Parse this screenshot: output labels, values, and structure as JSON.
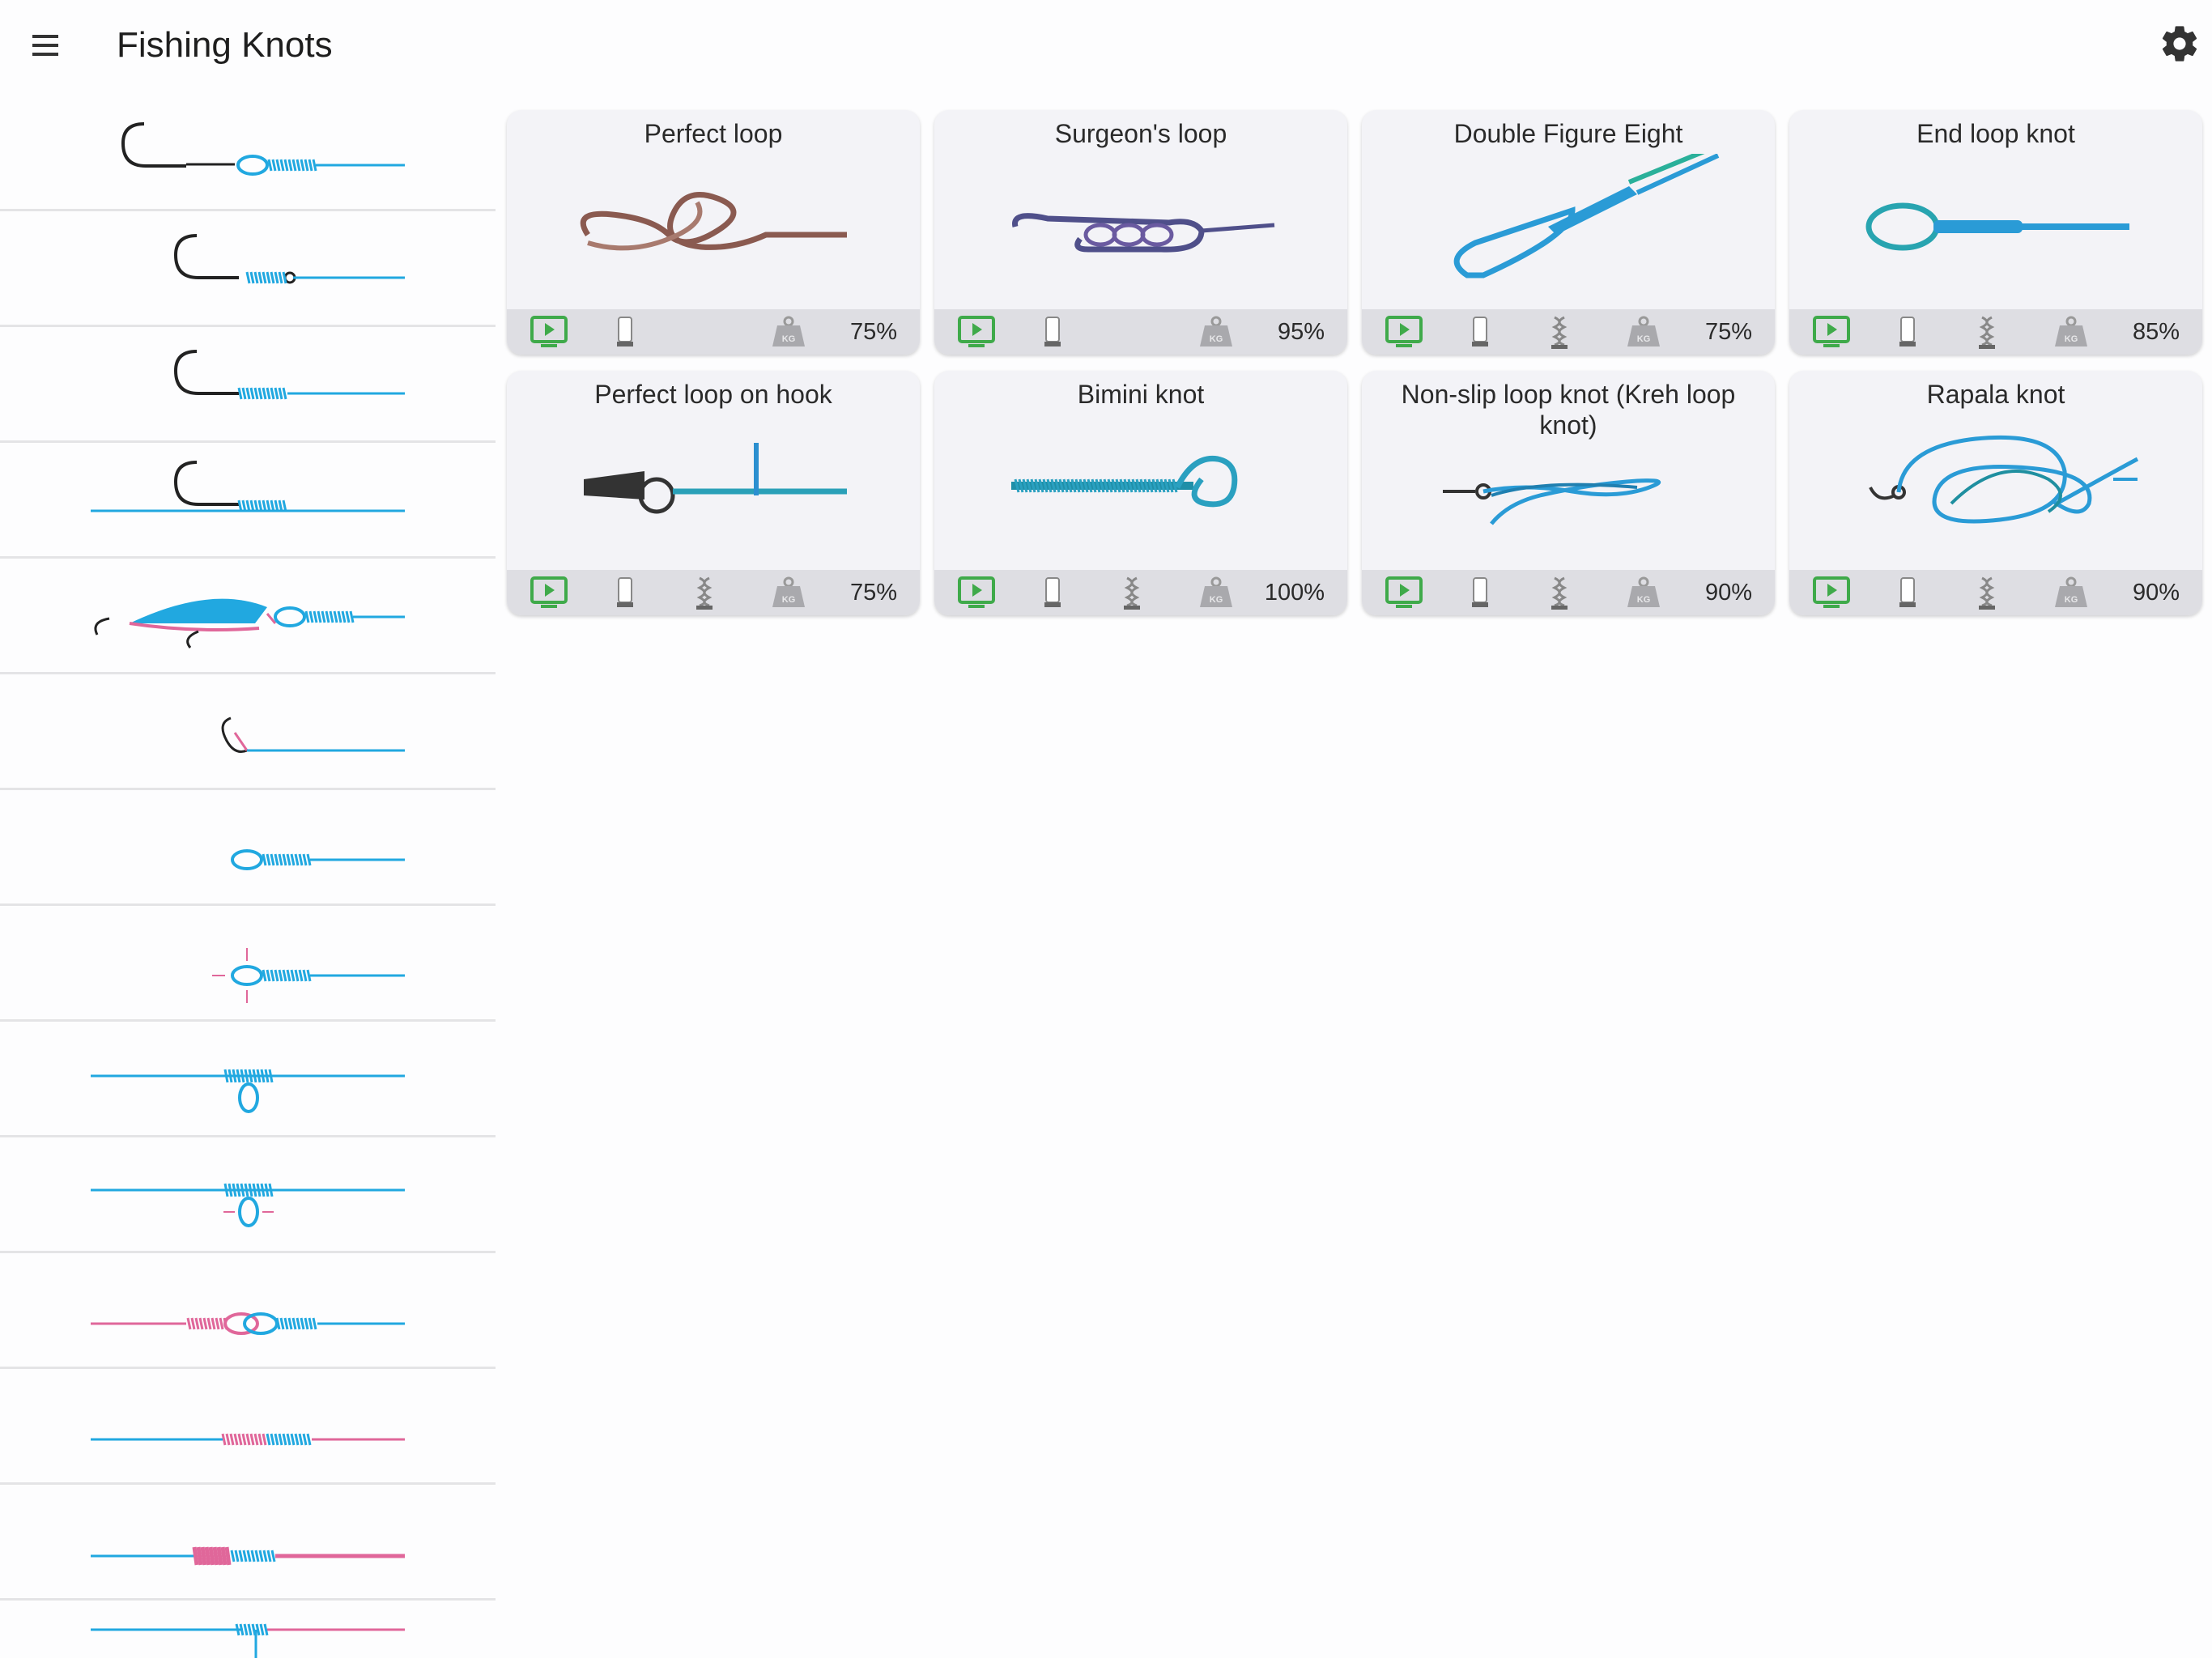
{
  "app": {
    "title": "Fishing Knots",
    "menu_icon": "hamburger-menu-icon",
    "settings_icon": "gear-icon"
  },
  "sidebar": {
    "items": [
      {
        "icon": "hook-loop-knot-icon"
      },
      {
        "icon": "hook-eye-knot-icon"
      },
      {
        "icon": "hook-shank-knot-icon"
      },
      {
        "icon": "hook-line-through-icon"
      },
      {
        "icon": "lure-loop-knot-icon"
      },
      {
        "icon": "snap-swivel-knot-icon"
      },
      {
        "icon": "end-loop-icon"
      },
      {
        "icon": "end-loop-crosshair-icon"
      },
      {
        "icon": "dropper-loop-icon"
      },
      {
        "icon": "dropper-loop-crosshair-icon"
      },
      {
        "icon": "loop-to-loop-icon"
      },
      {
        "icon": "line-to-line-icon"
      },
      {
        "icon": "leader-to-line-icon"
      },
      {
        "icon": "line-to-line-tag-icon"
      }
    ]
  },
  "knots": [
    {
      "title": "Perfect loop",
      "percent": "75%",
      "braid": false,
      "colors": [
        "#8a5a50",
        "#a87a6e"
      ]
    },
    {
      "title": "Surgeon's loop",
      "percent": "95%",
      "braid": false,
      "colors": [
        "#4f4f8a",
        "#6a5aa0"
      ]
    },
    {
      "title": "Double Figure Eight",
      "percent": "75%",
      "braid": true,
      "colors": [
        "#2a9bd6",
        "#2ab09a"
      ]
    },
    {
      "title": "End loop knot",
      "percent": "85%",
      "braid": true,
      "colors": [
        "#2a9bd6",
        "#28a4b0"
      ]
    },
    {
      "title": "Perfect loop on hook",
      "percent": "75%",
      "braid": true,
      "colors": [
        "#2aa0b8",
        "#2b8fd0"
      ]
    },
    {
      "title": "Bimini knot",
      "percent": "100%",
      "braid": true,
      "colors": [
        "#1f8fa8",
        "#2aa0c0"
      ]
    },
    {
      "title": "Non-slip loop knot  (Kreh loop knot)",
      "percent": "90%",
      "braid": true,
      "colors": [
        "#2a9bd6",
        "#1f7fb0"
      ]
    },
    {
      "title": "Rapala knot",
      "percent": "90%",
      "braid": true,
      "colors": [
        "#2a9bd6",
        "#1f8fa0"
      ]
    }
  ],
  "footer_icons": {
    "video": "video-play-icon",
    "mono": "mono-line-icon",
    "braid": "braid-line-icon",
    "weight": "kg-weight-icon"
  },
  "palette": {
    "line_blue": "#21a8e0",
    "line_pink": "#e0679a",
    "video_green": "#3faa4a",
    "card_bg": "#f3f3f7",
    "footer_bg": "#dedee3"
  }
}
